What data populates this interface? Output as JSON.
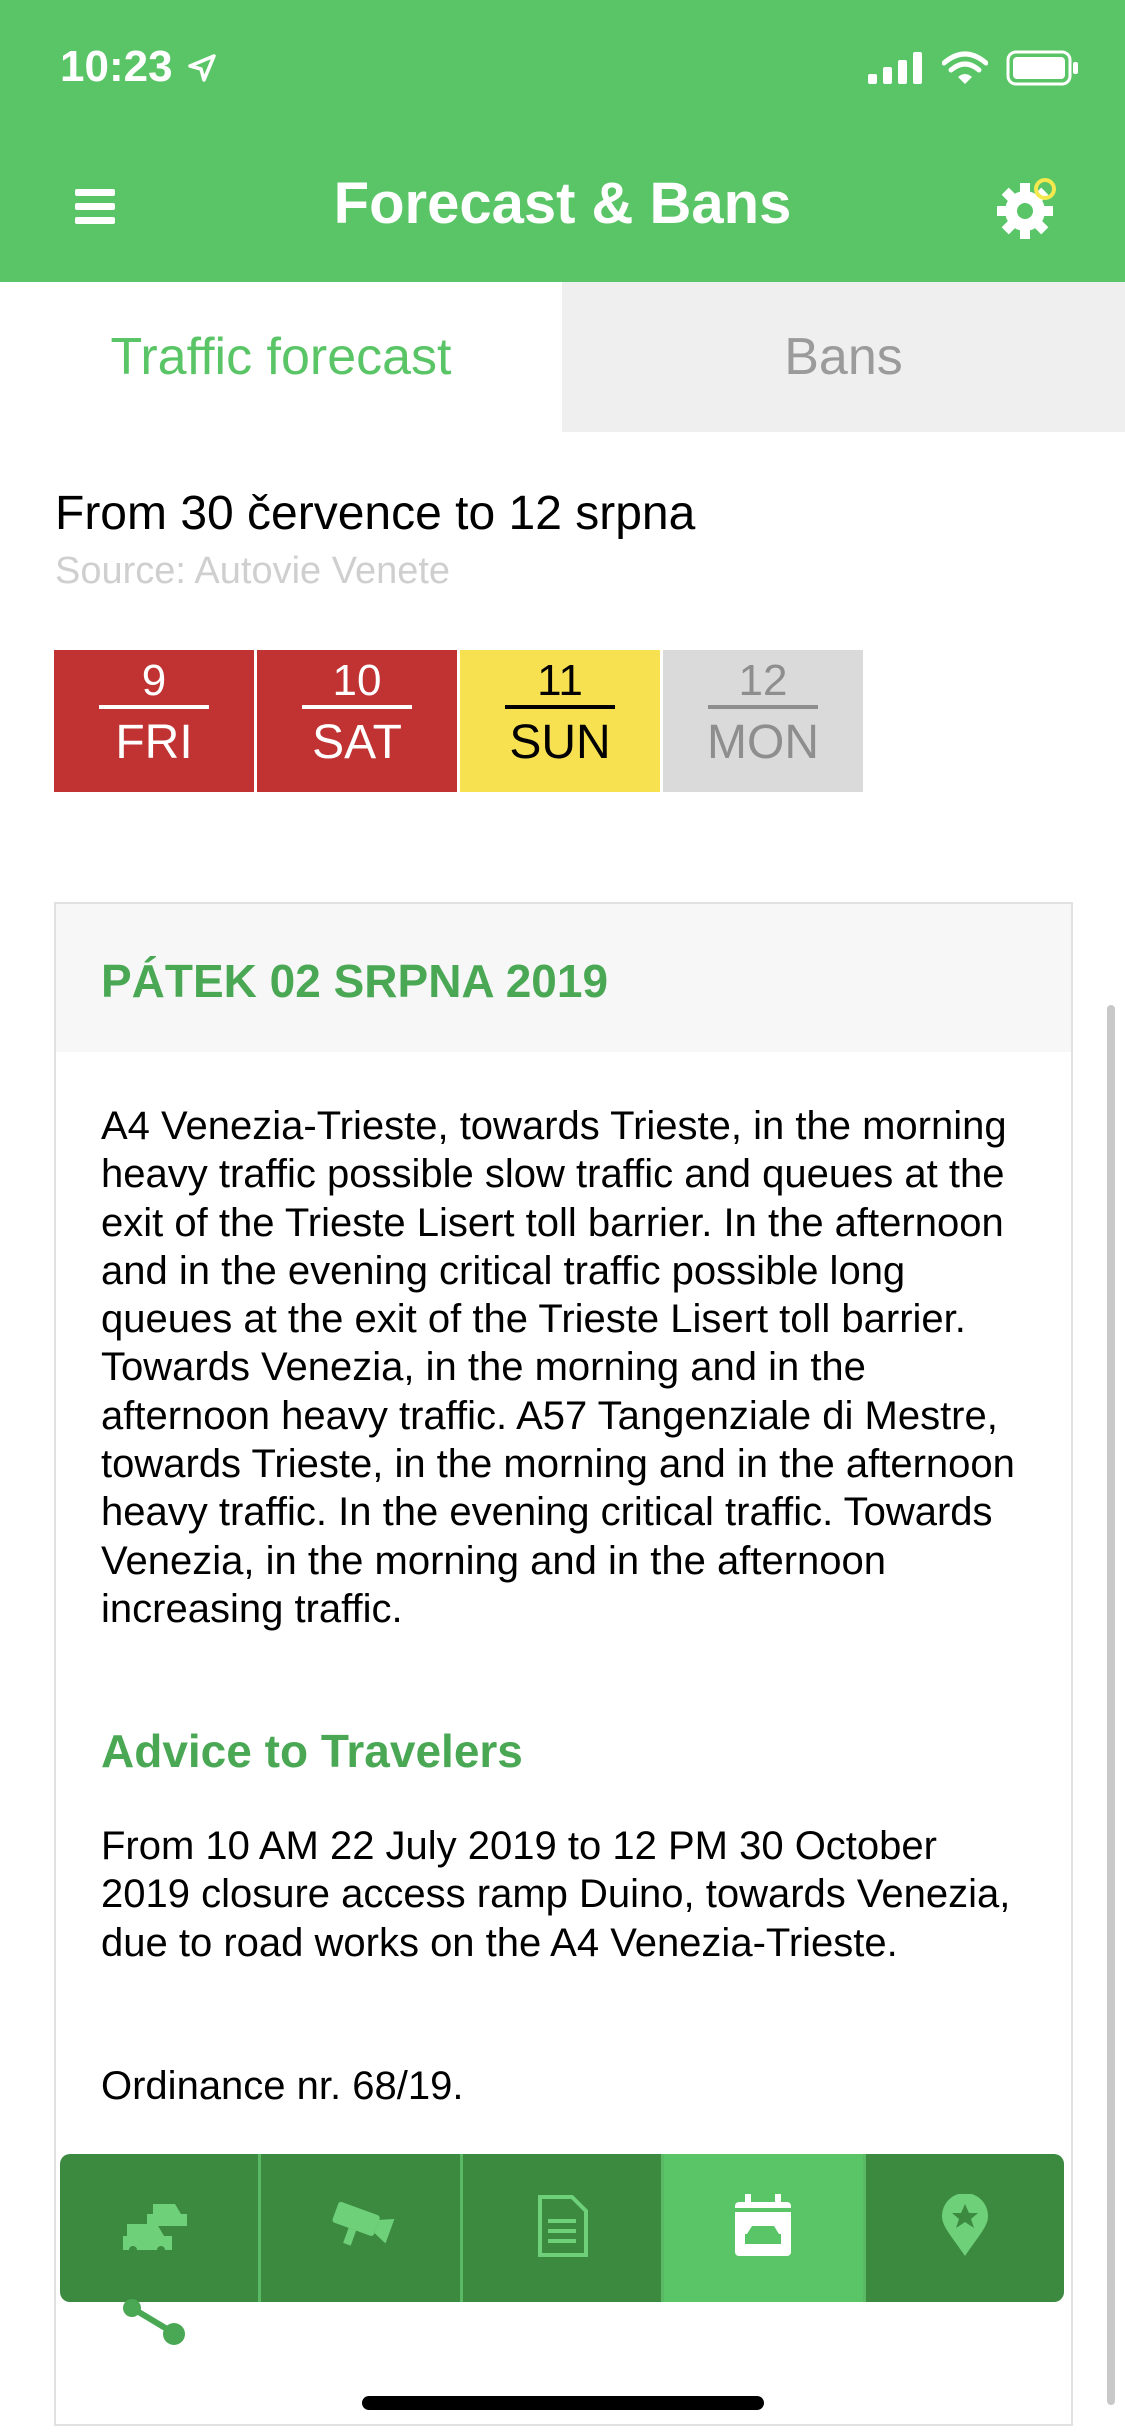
{
  "status_bar": {
    "time": "10:23"
  },
  "header": {
    "title": "Forecast & Bans"
  },
  "tabs": [
    {
      "label": "Traffic forecast",
      "active": true
    },
    {
      "label": "Bans",
      "active": false
    }
  ],
  "period": {
    "range": "From 30 července to 12 srpna",
    "source": "Source: Autovie Venete"
  },
  "days": [
    {
      "num": "9",
      "dow": "FRI",
      "status": "red",
      "color": "#c03332"
    },
    {
      "num": "10",
      "dow": "SAT",
      "status": "red",
      "color": "#c03332"
    },
    {
      "num": "11",
      "dow": "SUN",
      "status": "yellow",
      "color": "#f8e150"
    },
    {
      "num": "12",
      "dow": "MON",
      "status": "grey",
      "color": "#dadada"
    }
  ],
  "forecast": {
    "date": "PÁTEK 02 SRPNA 2019",
    "text": "A4 Venezia-Trieste, towards Trieste, in the morning heavy traffic possible slow traffic and queues at the exit of the Trieste Lisert toll barrier. In the afternoon and in the evening critical traffic possible long queues at the exit of the Trieste Lisert toll barrier. Towards Venezia, in the morning and in the afternoon heavy traffic. A57 Tangenziale di Mestre, towards Trieste, in the morning and in the afternoon heavy traffic. In the evening critical traffic. Towards Venezia, in the morning and in the afternoon increasing traffic.",
    "advice_title": "Advice to Travelers",
    "advice_text": "From 10 AM 22 July 2019 to 12 PM 30 October 2019 closure access ramp Duino, towards Venezia, due to road works on the A4 Venezia-Trieste.",
    "ordinance": "Ordinance nr. 68/19."
  },
  "bottom_nav": [
    {
      "icon": "traffic-icon",
      "active": false
    },
    {
      "icon": "camera-icon",
      "active": false
    },
    {
      "icon": "document-icon",
      "active": false
    },
    {
      "icon": "calendar-car-icon",
      "active": true
    },
    {
      "icon": "map-pin-star-icon",
      "active": false
    }
  ],
  "colors": {
    "brand_green": "#5ac566",
    "dark_green": "#3b8a40",
    "heading_green": "#4aa855"
  }
}
